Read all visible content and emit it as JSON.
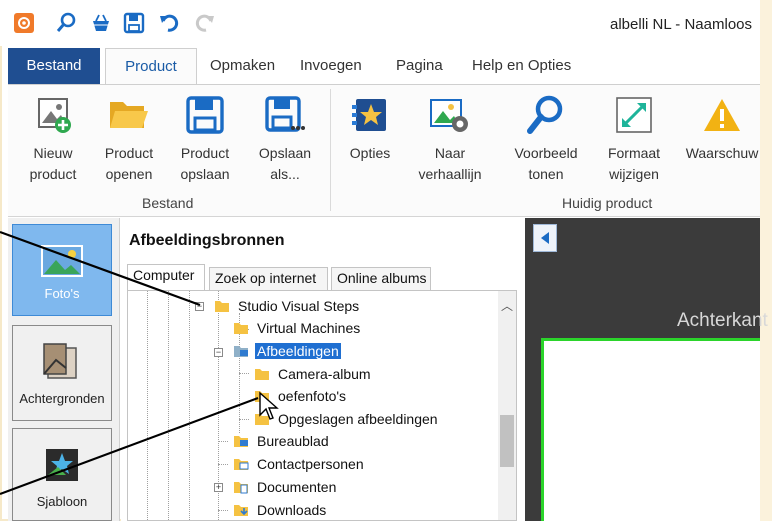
{
  "window": {
    "title": "albelli NL - Naamloos"
  },
  "qat": {
    "icons": [
      "app-logo-icon",
      "search-icon",
      "basket-icon",
      "save-icon",
      "undo-icon",
      "redo-icon"
    ]
  },
  "tabs": [
    {
      "label": "Bestand"
    },
    {
      "label": "Product"
    },
    {
      "label": "Opmaken"
    },
    {
      "label": "Invoegen"
    },
    {
      "label": "Pagina"
    },
    {
      "label": "Help en Opties"
    }
  ],
  "ribbon": {
    "buttons": [
      {
        "label": "Nieuw\nproduct",
        "icon": "new-product-icon"
      },
      {
        "label": "Product\nopenen",
        "icon": "folder-open-icon"
      },
      {
        "label": "Product\nopslaan",
        "icon": "save-icon"
      },
      {
        "label": "Opslaan\nals...",
        "icon": "save-as-icon"
      },
      {
        "label": "Opties",
        "icon": "options-star-icon"
      },
      {
        "label": "Naar\nverhaallijn",
        "icon": "storyline-icon"
      },
      {
        "label": "Voorbeeld\ntonen",
        "icon": "preview-search-icon"
      },
      {
        "label": "Formaat\nwijzigen",
        "icon": "resize-icon"
      },
      {
        "label": "Waarschuw",
        "icon": "warning-icon"
      }
    ],
    "groups": [
      {
        "label": "Bestand"
      },
      {
        "label": "Huidig product"
      }
    ]
  },
  "leftnav": [
    {
      "label": "Foto's",
      "icon": "photo-icon"
    },
    {
      "label": "Achtergronden",
      "icon": "backgrounds-icon"
    },
    {
      "label": "Sjabloon",
      "icon": "template-icon"
    }
  ],
  "sources": {
    "heading": "Afbeeldingsbronnen",
    "tabs": [
      {
        "label": "Computer"
      },
      {
        "label": "Zoek op internet"
      },
      {
        "label": "Online albums"
      }
    ],
    "tree": [
      {
        "label": "Studio Visual Steps"
      },
      {
        "label": "Virtual Machines"
      },
      {
        "label": "Afbeeldingen"
      },
      {
        "label": "Camera-album"
      },
      {
        "label": "oefenfoto's"
      },
      {
        "label": "Opgeslagen afbeeldingen"
      },
      {
        "label": "Bureaublad"
      },
      {
        "label": "Contactpersonen"
      },
      {
        "label": "Documenten"
      },
      {
        "label": "Downloads"
      }
    ]
  },
  "canvas": {
    "back_label": "Achterkant"
  },
  "colors": {
    "file_tab": "#1f4e91",
    "accent_blue": "#1a5ba6",
    "selection": "#1f6fd1",
    "active_nav": "#7fb8ee",
    "page_border": "#2bd42b",
    "folder": "#f5c242"
  }
}
